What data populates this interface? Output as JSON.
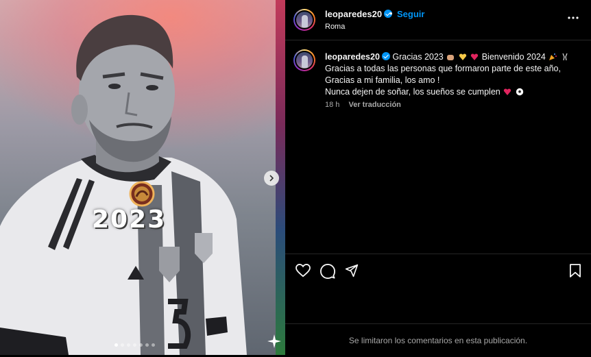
{
  "media": {
    "year_badge": "2023",
    "carousel": {
      "total": 7,
      "active_index": 0
    },
    "colors": {
      "edge_red": "#c23a5a",
      "edge_green": "#2d7a3c"
    }
  },
  "header": {
    "username": "leoparedes20",
    "separator": "•",
    "follow_label": "Seguir",
    "location": "Roma"
  },
  "caption": {
    "username": "leoparedes20",
    "line1": "Gracias 2023",
    "line1_b": "Bienvenido 2024",
    "line2": "Gracias a todas las personas que formaron parte de este año,",
    "line3": "Gracias a mi familia, los amo !",
    "line4": "Nunca dejen de soñar, los sueños se cumplen",
    "time": "18 h",
    "translate_label": "Ver traducción"
  },
  "actions": {
    "icons": [
      "heart-icon",
      "comment-icon",
      "share-icon",
      "bookmark-icon"
    ]
  },
  "footer": {
    "comments_notice": "Se limitaron los comentarios en esta publicación."
  },
  "colors": {
    "link_blue": "#0095f6",
    "background": "#000000",
    "secondary_text": "#a8a8a8"
  }
}
